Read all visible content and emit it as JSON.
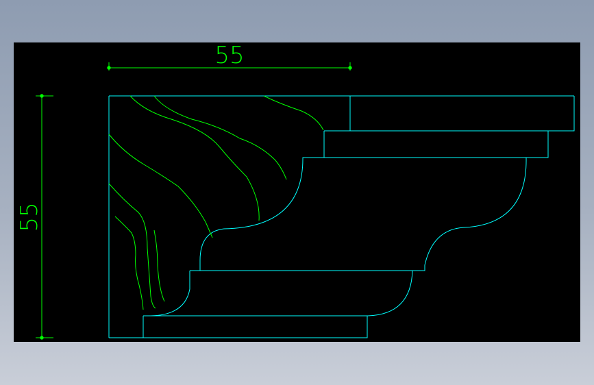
{
  "drawing": {
    "background_color": "#000000",
    "outline_color": "#00ffff",
    "hatch_color": "#00ff00",
    "dimension_color": "#00ff00"
  },
  "dimensions": {
    "horizontal_label": "55",
    "vertical_label": "55"
  }
}
